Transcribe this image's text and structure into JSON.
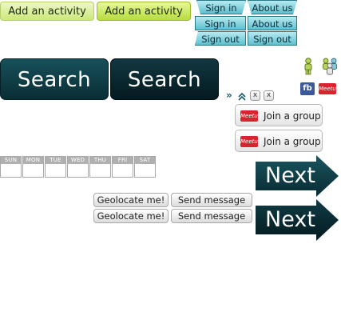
{
  "activity": {
    "button1": "Add an activity",
    "button2": "Add an activity"
  },
  "auth": {
    "row1": [
      "Sign in",
      "About us"
    ],
    "row2": [
      "Sign in",
      "About us"
    ],
    "row3": [
      "Sign out",
      "Sign out"
    ]
  },
  "search": {
    "button1": "Search",
    "button2": "Search"
  },
  "icons": {
    "person": "person-icon",
    "group": "group-icon",
    "facebook": "facebook-icon",
    "meetup": "meetup-icon",
    "fb_label": "fb",
    "meetup_label": "Meetup"
  },
  "controls": {
    "close1": "x",
    "close2": "x"
  },
  "join": {
    "button1": "Join a group",
    "button2": "Join a group"
  },
  "calendar": {
    "days": [
      "SUN",
      "MON",
      "TUE",
      "WED",
      "THU",
      "FRI",
      "SAT"
    ]
  },
  "geo": {
    "row1": [
      "Geolocate me!",
      "Send message"
    ],
    "row2": [
      "Geolocate me!",
      "Send message"
    ]
  },
  "next": {
    "button1": "Next",
    "button2": "Next"
  },
  "colors": {
    "teal_dark": "#0a2e35",
    "lime": "#b7dd3c",
    "tab_teal": "#5dbfcf",
    "meetup_red": "#d9232e"
  }
}
